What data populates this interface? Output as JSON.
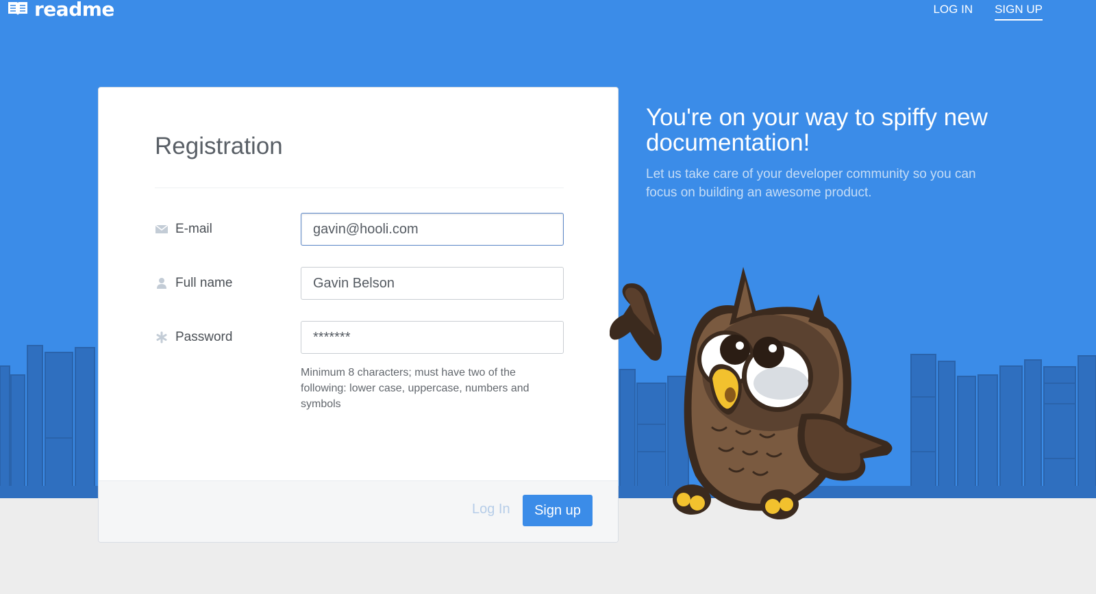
{
  "brand": {
    "name": "readme"
  },
  "nav": {
    "login_label": "LOG IN",
    "signup_label": "SIGN UP"
  },
  "form": {
    "title": "Registration",
    "fields": [
      {
        "label": "E-mail",
        "value": "gavin@hooli.com",
        "icon": "envelope-icon"
      },
      {
        "label": "Full name",
        "value": "Gavin Belson",
        "icon": "user-icon"
      },
      {
        "label": "Password",
        "value": "*******",
        "icon": "asterisk-icon"
      }
    ],
    "password_hint": "Minimum 8 characters; must have two of the following: lower case, uppercase, numbers and symbols",
    "footer": {
      "login_label": "Log In",
      "signup_label": "Sign up"
    }
  },
  "promo": {
    "headline": "You're on your way to spiffy new documentation!",
    "subline": "Let us take care of your developer community so you can focus on building an awesome product."
  },
  "colors": {
    "accent": "#3b8ce8",
    "shelf": "#2f6fbf",
    "ground": "#ededed"
  }
}
